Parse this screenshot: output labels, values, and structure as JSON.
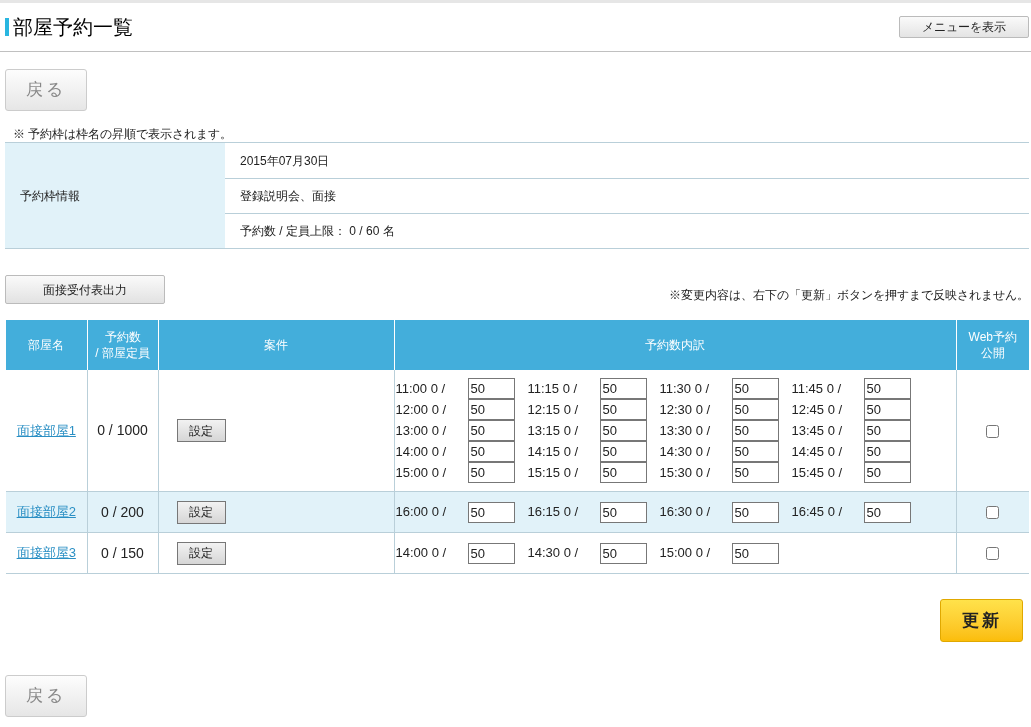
{
  "page": {
    "title": "部屋予約一覧",
    "menu_button": "メニューを表示"
  },
  "back_button_top": "戻る",
  "note": "※ 予約枠は枠名の昇順で表示されます。",
  "slot_info": {
    "label": "予約枠情報",
    "rows": [
      "2015年07月30日",
      "登録説明会、面接",
      "予約数 / 定員上限： 0 / 60 名"
    ]
  },
  "export_button": "面接受付表出力",
  "change_note": "※変更内容は、右下の「更新」ボタンを押すまで反映されません。",
  "table": {
    "columns": [
      "部屋名",
      "予約数\n/ 部屋定員",
      "案件",
      "予約数内訳",
      "Web予約公開"
    ],
    "rows": [
      {
        "room": "面接部屋1",
        "count": "0 / 1000",
        "settings_button": "設定",
        "web_public": false,
        "slots": [
          {
            "label": "11:00 0 /",
            "capacity": "50"
          },
          {
            "label": "11:15 0 /",
            "capacity": "50"
          },
          {
            "label": "11:30 0 /",
            "capacity": "50"
          },
          {
            "label": "11:45 0 /",
            "capacity": "50"
          },
          {
            "label": "12:00 0 /",
            "capacity": "50"
          },
          {
            "label": "12:15 0 /",
            "capacity": "50"
          },
          {
            "label": "12:30 0 /",
            "capacity": "50"
          },
          {
            "label": "12:45 0 /",
            "capacity": "50"
          },
          {
            "label": "13:00 0 /",
            "capacity": "50"
          },
          {
            "label": "13:15 0 /",
            "capacity": "50"
          },
          {
            "label": "13:30 0 /",
            "capacity": "50"
          },
          {
            "label": "13:45 0 /",
            "capacity": "50"
          },
          {
            "label": "14:00 0 /",
            "capacity": "50"
          },
          {
            "label": "14:15 0 /",
            "capacity": "50"
          },
          {
            "label": "14:30 0 /",
            "capacity": "50"
          },
          {
            "label": "14:45 0 /",
            "capacity": "50"
          },
          {
            "label": "15:00 0 /",
            "capacity": "50"
          },
          {
            "label": "15:15 0 /",
            "capacity": "50"
          },
          {
            "label": "15:30 0 /",
            "capacity": "50"
          },
          {
            "label": "15:45 0 /",
            "capacity": "50"
          }
        ]
      },
      {
        "room": "面接部屋2",
        "count": "0 / 200",
        "settings_button": "設定",
        "web_public": false,
        "slots": [
          {
            "label": "16:00 0 /",
            "capacity": "50"
          },
          {
            "label": "16:15 0 /",
            "capacity": "50"
          },
          {
            "label": "16:30 0 /",
            "capacity": "50"
          },
          {
            "label": "16:45 0 /",
            "capacity": "50"
          }
        ]
      },
      {
        "room": "面接部屋3",
        "count": "0 / 150",
        "settings_button": "設定",
        "web_public": false,
        "slots": [
          {
            "label": "14:00 0 /",
            "capacity": "50"
          },
          {
            "label": "14:30 0 /",
            "capacity": "50"
          },
          {
            "label": "15:00 0 /",
            "capacity": "50"
          }
        ]
      }
    ]
  },
  "update_button": "更新",
  "back_button_bottom": "戻る"
}
